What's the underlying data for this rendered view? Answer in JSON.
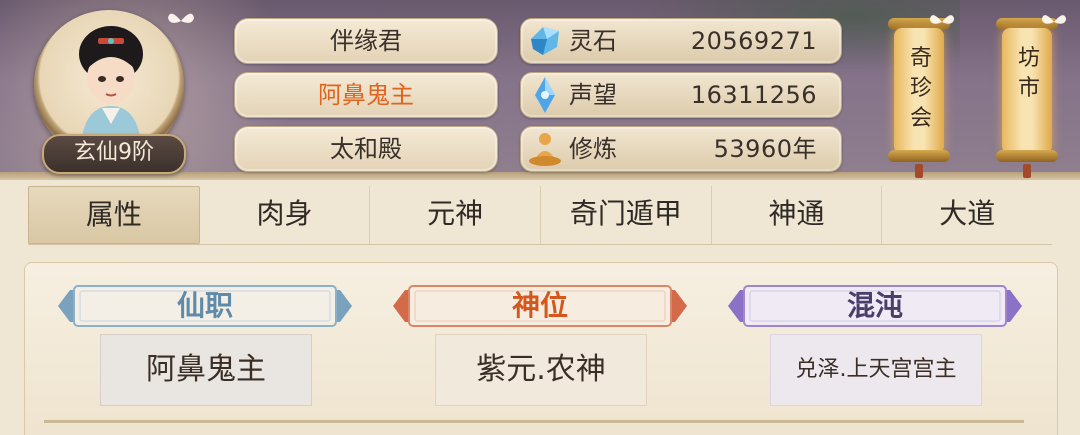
{
  "player": {
    "level_badge": "玄仙9阶",
    "name_plates": [
      "伴缘君",
      "阿鼻鬼主",
      "太和殿"
    ]
  },
  "resources": [
    {
      "icon": "spirit-stone-icon",
      "label": "灵石",
      "value": "20569271"
    },
    {
      "icon": "prestige-crystal-icon",
      "label": "声望",
      "value": "16311256"
    },
    {
      "icon": "meditation-icon",
      "label": "修炼",
      "value": "53960年"
    }
  ],
  "lanterns": [
    {
      "label": "奇珍会"
    },
    {
      "label": "坊市"
    }
  ],
  "tabs": [
    "属性",
    "肉身",
    "元神",
    "奇门遁甲",
    "神通",
    "大道"
  ],
  "active_tab": "属性",
  "cards": [
    {
      "title": "仙职",
      "value": "阿鼻鬼主",
      "color": "#5f8aa8"
    },
    {
      "title": "神位",
      "value": "紫元.农神",
      "color": "#d4581e"
    },
    {
      "title": "混沌",
      "value": "兑泽.上天宫宫主",
      "color": "#4a3e6a"
    }
  ],
  "colors": {
    "header_bg": "#7a6a7c",
    "accent_orange": "#e0631e",
    "panel_bg": "#f6efe1"
  }
}
